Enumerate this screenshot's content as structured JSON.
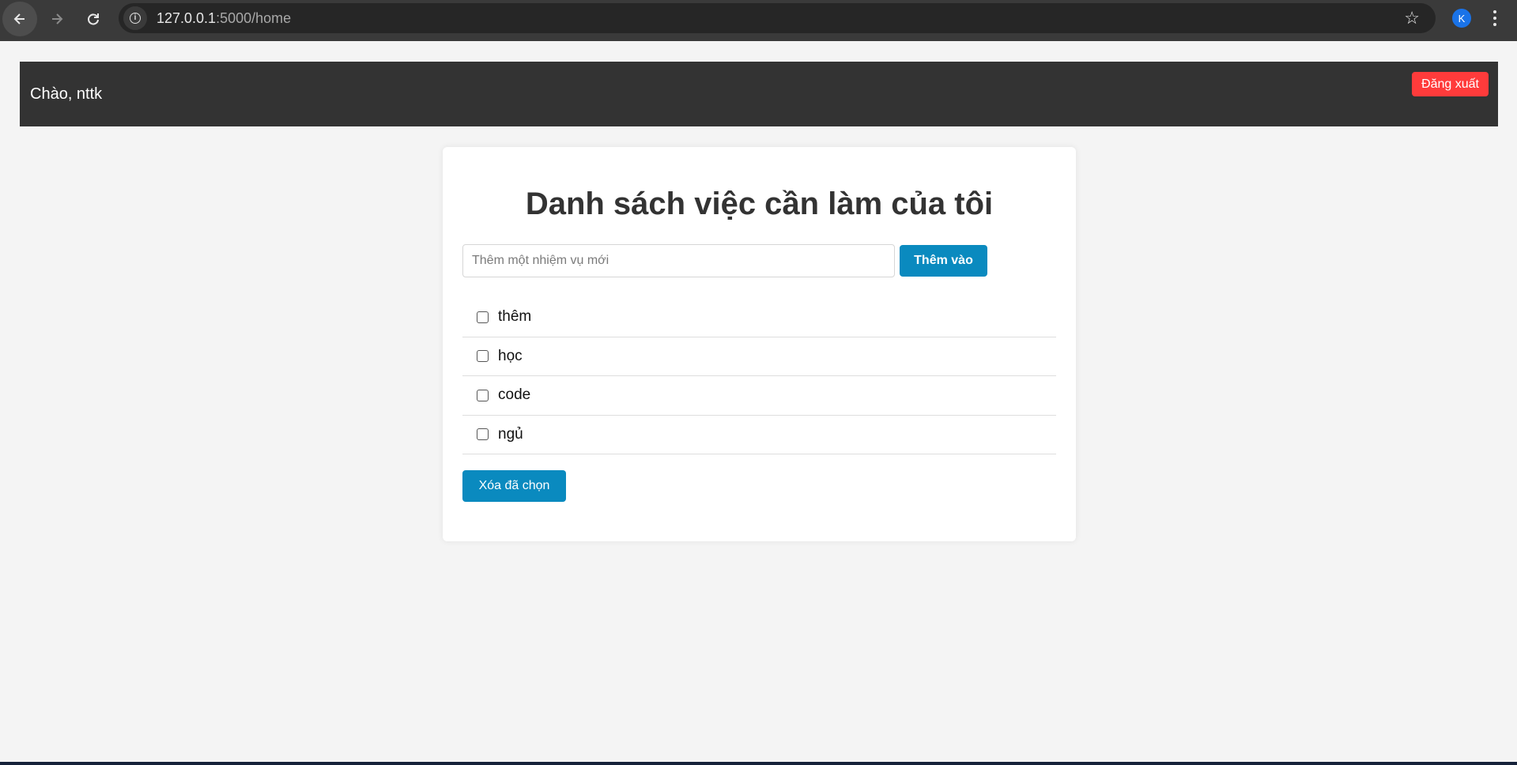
{
  "browser": {
    "url_host": "127.0.0.1",
    "url_path": ":5000/home",
    "profile_initial": "K",
    "icons": [
      "back-arrow-icon",
      "forward-arrow-icon",
      "reload-icon",
      "site-info-icon",
      "bookmark-star-icon",
      "more-menu-icon"
    ]
  },
  "header": {
    "greeting": "Chào, nttk",
    "logout_label": "Đăng xuất"
  },
  "todo": {
    "title": "Danh sách việc cần làm của tôi",
    "input_placeholder": "Thêm một nhiệm vụ mới",
    "input_value": "",
    "add_label": "Thêm vào",
    "tasks": [
      {
        "label": "thêm",
        "checked": false
      },
      {
        "label": "học",
        "checked": false
      },
      {
        "label": "code",
        "checked": false
      },
      {
        "label": "ngủ",
        "checked": false
      }
    ],
    "delete_label": "Xóa đã chọn"
  },
  "colors": {
    "header_bg": "#333333",
    "logout_bg": "#ff3b3b",
    "primary_button": "#0a8abf",
    "page_bg": "#f4f4f4"
  }
}
